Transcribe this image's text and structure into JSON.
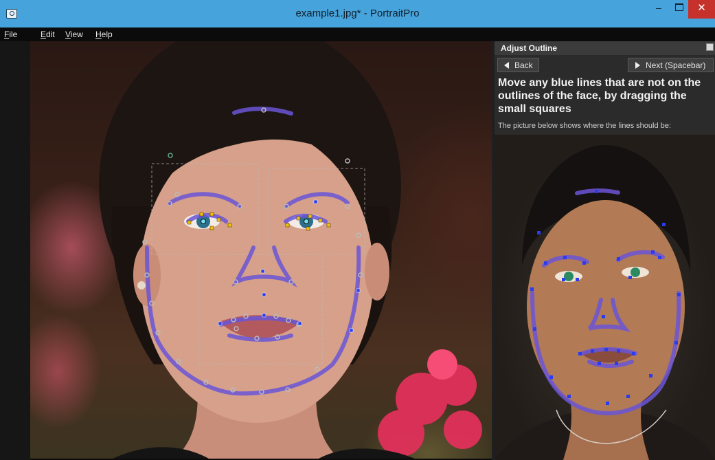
{
  "window": {
    "title": "example1.jpg* - PortraitPro",
    "minimize_glyph": "–",
    "close_glyph": "✕"
  },
  "menu": {
    "items": [
      "File",
      "Edit",
      "View",
      "Help"
    ]
  },
  "panel": {
    "title": "Adjust Outline",
    "back_label": "Back",
    "next_label": "Next (Spacebar)",
    "instruction": "Move any blue lines that are not on the outlines of the face, by dragging the small squares",
    "subtext": "The picture below shows where the lines should be:"
  },
  "icons": {
    "app": "camera-icon",
    "minimize": "minimize-icon",
    "maximize": "maximize-icon",
    "close": "close-icon",
    "restore": "restore-panel-icon",
    "back": "triangle-left-icon",
    "next": "triangle-right-icon"
  },
  "colors": {
    "titlebar": "#46a3db",
    "close_button": "#c7312b",
    "outline_line": "#6a55d6",
    "control_square": "#2a3cf0",
    "eye_square": "#f2c10f",
    "panel_background": "#2b2b2b"
  }
}
